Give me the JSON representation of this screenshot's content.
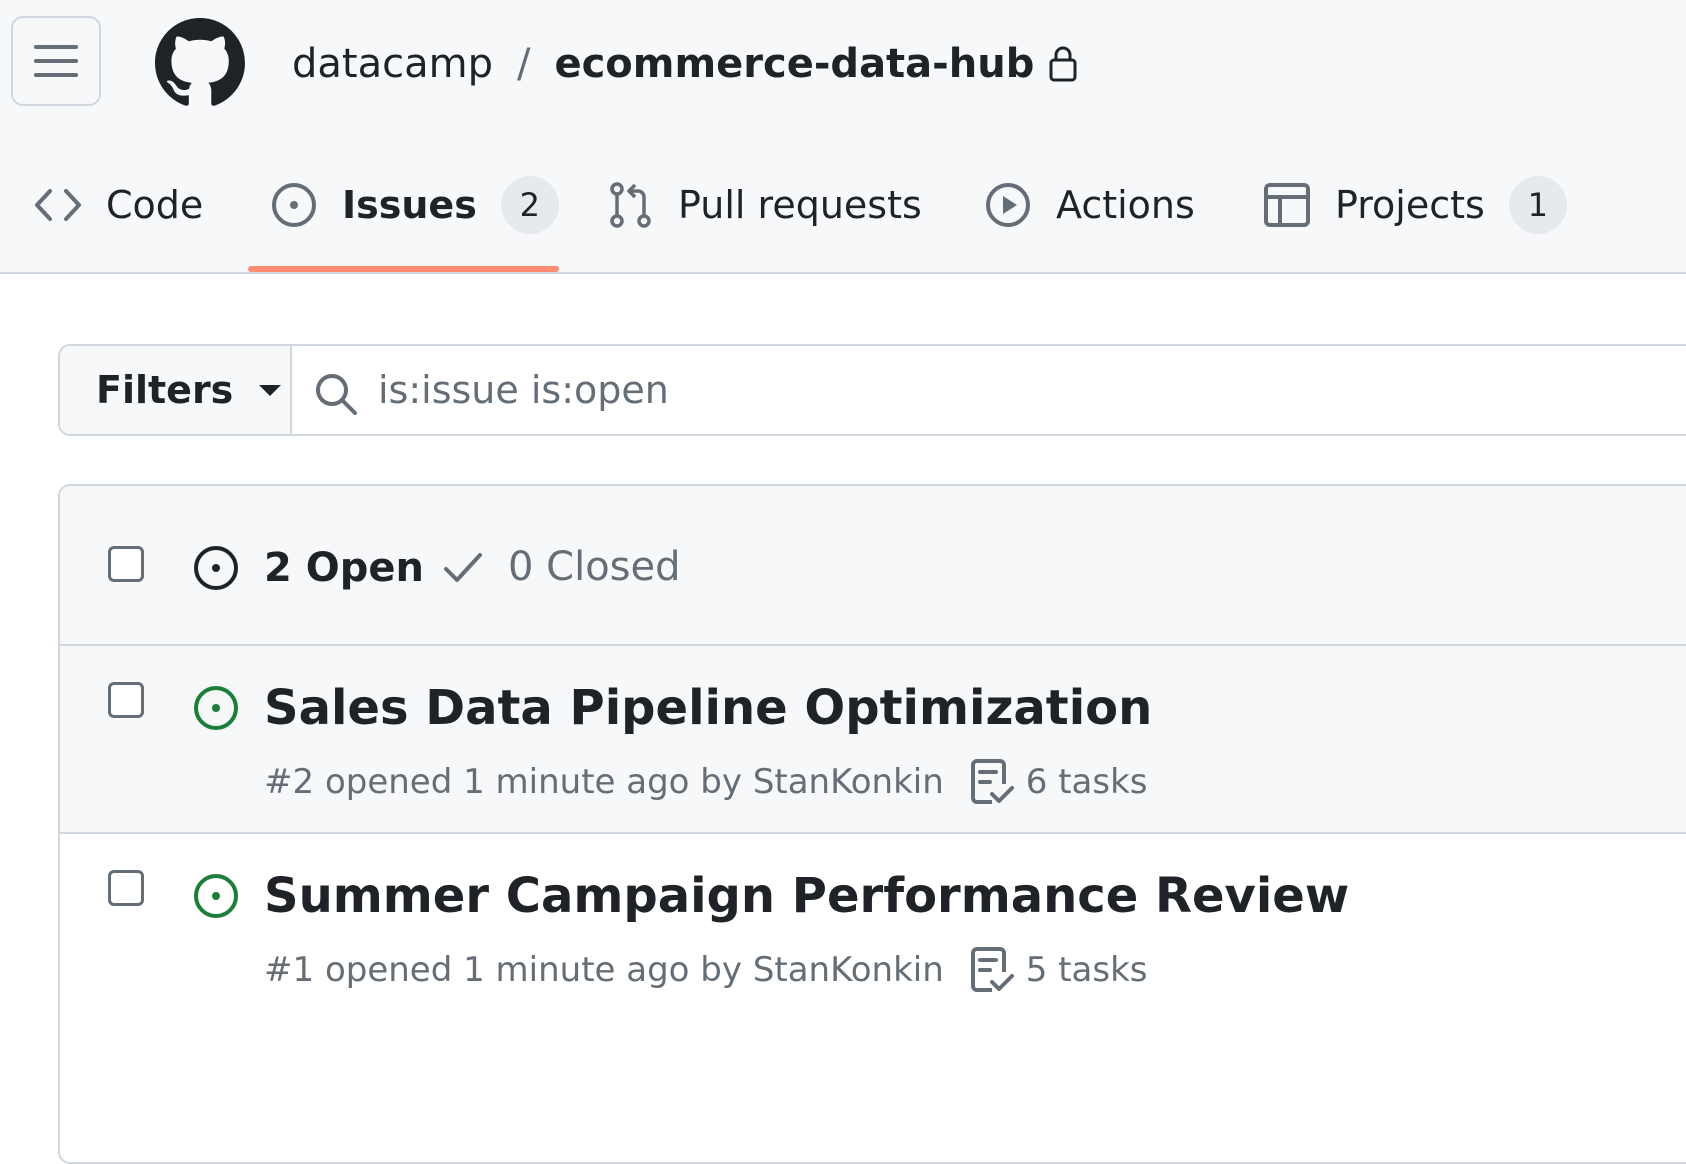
{
  "header": {
    "owner": "datacamp",
    "separator": "/",
    "repo": "ecommerce-data-hub"
  },
  "tabs": [
    {
      "label": "Code",
      "icon": "code-icon"
    },
    {
      "label": "Issues",
      "icon": "issue-opened-icon",
      "counter": "2",
      "selected": true
    },
    {
      "label": "Pull requests",
      "icon": "git-pull-request-icon"
    },
    {
      "label": "Actions",
      "icon": "play-icon"
    },
    {
      "label": "Projects",
      "icon": "table-icon",
      "counter": "1"
    }
  ],
  "filters": {
    "button_label": "Filters",
    "search_value": "is:issue is:open"
  },
  "issues_header": {
    "open_label": "2 Open",
    "closed_label": "0 Closed"
  },
  "issues": [
    {
      "title": "Sales Data Pipeline Optimization",
      "number": "#2",
      "opened": "opened 1 minute ago by",
      "author": "StanKonkin",
      "tasks": "6 tasks"
    },
    {
      "title": "Summer Campaign Performance Review",
      "number": "#1",
      "opened": "opened 1 minute ago by",
      "author": "StanKonkin",
      "tasks": "5 tasks"
    }
  ],
  "colors": {
    "accent_underline": "#fd8c73",
    "open_green": "#1a7f37",
    "muted": "#656d76",
    "border": "#d0d7de"
  }
}
